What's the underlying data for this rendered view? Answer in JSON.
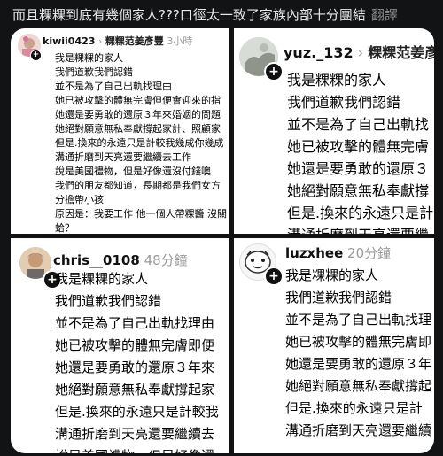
{
  "header": {
    "title": "而且粿粿到底有幾個家人???口徑太一致了家族內部十分團結",
    "translate_label": "翻譯"
  },
  "posts": [
    {
      "username": "kiwii0423",
      "page_name": "粿粿范姜彥豐",
      "time": "3小時",
      "lines": [
        "我是粿粿的家人",
        "我們道歉我們認錯",
        "並不是為了自己出軌找理由",
        "她已被攻擊的體無完膚但便會迎來的指",
        "她還是要勇敢的還原３年來婚姻的問題",
        "她絕對願意無私奉獻撐起家計、照顧家",
        "但是.換來的永遠只是計較我幾成你幾成",
        "溝通折磨到天亮還要繼續去工作",
        "說是美國禮物，但是好像還沒付錢噢",
        "我們的朋友都知道，長期都是我們女方",
        "分擔帶小孩",
        "原因是：我要工作 他一個人帶粿醬 沒關",
        "蛤？"
      ]
    },
    {
      "username": "yuz._132",
      "page_name": "粿粿范姜彥",
      "time": "",
      "lines": [
        "我是粿粿的家人",
        "我們道歉我們認錯",
        "並不是為了自己出軌找",
        "她已被攻擊的體無完膚",
        "她還是要勇敢的還原３",
        "她絕對願意無私奉獻撐",
        "但是.換來的永遠只是計",
        "溝通折磨到天亮還要繼"
      ]
    },
    {
      "username": "chris__0108",
      "page_name": "",
      "time": "48分鐘",
      "lines": [
        "我是粿粿的家人",
        "我們道歉我們認錯",
        "並不是為了自己出軌找理由",
        "她已被攻擊的體無完膚即便",
        "她還是要勇敢的還原３年來",
        "她絕對願意無私奉獻撐起家",
        "但是.換來的永遠只是計較我",
        "溝通折磨到天亮還要繼續去",
        "說是美國禮物，但是好像還"
      ]
    },
    {
      "username": "luzxhee",
      "page_name": "",
      "time": "20分鐘",
      "lines": [
        "我是粿粿的家人",
        "我們道歉我們認錯",
        "並不是為了自己出軌找理",
        "她已被攻擊的體無完膚即",
        "她還是要勇敢的還原３年",
        "她絕對願意無私奉獻撐起",
        "但是.換來的永遠只是計",
        "溝通折磨到天亮還要繼續"
      ]
    }
  ]
}
